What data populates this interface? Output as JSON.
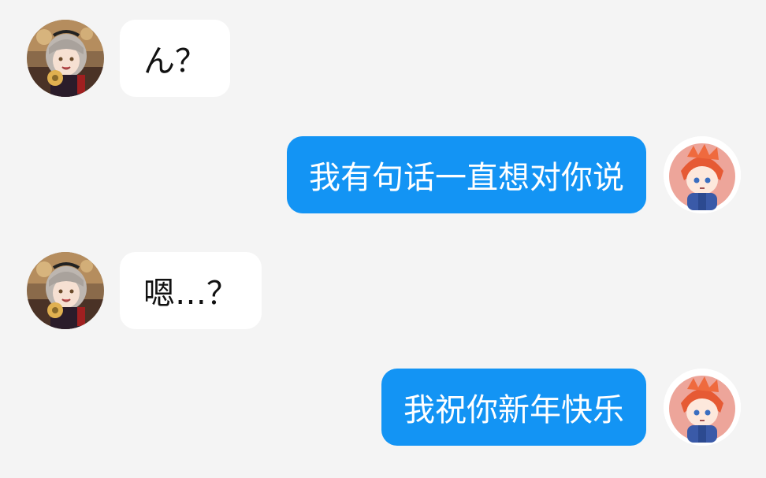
{
  "colors": {
    "background": "#f4f4f4",
    "incoming_bubble": "#ffffff",
    "outgoing_bubble": "#1394f4"
  },
  "contact_avatar_icon": "anime-girl-avatar-icon",
  "user_avatar_icon": "red-hair-boy-avatar-icon",
  "messages": [
    {
      "sender": "contact",
      "text": "ん？"
    },
    {
      "sender": "me",
      "text": "我有句话一直想对你说"
    },
    {
      "sender": "contact",
      "text": "嗯…？"
    },
    {
      "sender": "me",
      "text": "我祝你新年快乐"
    }
  ]
}
